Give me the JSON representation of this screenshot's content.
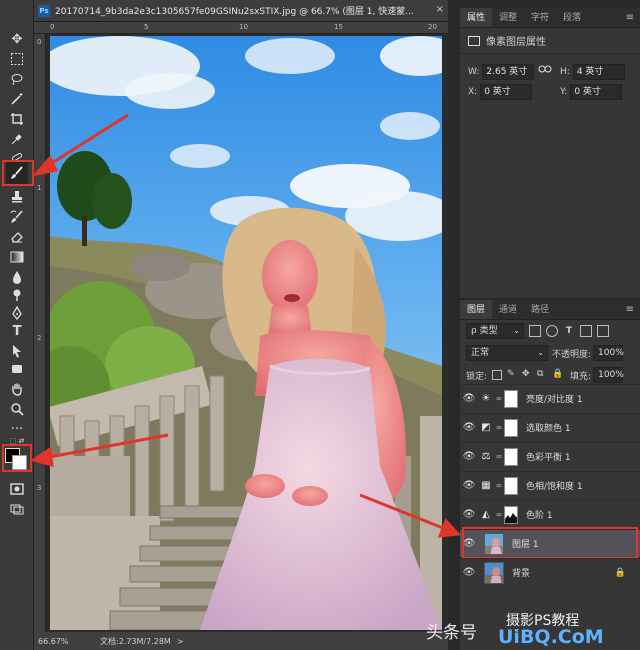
{
  "document": {
    "ps_badge": "Ps",
    "tab_title": "20170714_9b3da2e3c1305657fe09GSINu2sxSTIX.jpg @ 66.7% (图层 1, 快速蒙...",
    "close": "×",
    "ruler_top": [
      "0",
      "5",
      "10",
      "15",
      "20"
    ],
    "ruler_left": [
      "0",
      "1",
      "2",
      "3"
    ],
    "zoom": "66.67%",
    "doc_size": "文档:2.73M/7.28M",
    "status_arrow": ">"
  },
  "toolbar": {
    "selected_tool": "brush-tool",
    "foreground_color": "#000000",
    "background_color": "#ffffff"
  },
  "properties": {
    "tabs": [
      "属性",
      "调整",
      "字符",
      "段落"
    ],
    "active_tab": "属性",
    "header": "像素图层属性",
    "w_label": "W:",
    "w_value": "2.65 英寸",
    "h_label": "H:",
    "h_value": "4 英寸",
    "x_label": "X:",
    "x_value": "0 英寸",
    "y_label": "Y:",
    "y_value": "0 英寸"
  },
  "layers_panel": {
    "tabs": [
      "图层",
      "通道",
      "路径"
    ],
    "active_tab": "图层",
    "filter_label": "ρ 类型",
    "blend_mode": "正常",
    "opacity_label": "不透明度:",
    "opacity_value": "100%",
    "lock_label": "锁定:",
    "fill_label": "填充:",
    "fill_value": "100%",
    "layers": [
      {
        "name": "亮度/对比度 1",
        "icon": "☀"
      },
      {
        "name": "选取颜色 1",
        "icon": "◩"
      },
      {
        "name": "色彩平衡 1",
        "icon": "⚖"
      },
      {
        "name": "色相/饱和度 1",
        "icon": "▦"
      },
      {
        "name": "色阶 1",
        "icon": "◭"
      },
      {
        "name": "图层 1"
      },
      {
        "name": "背景"
      }
    ],
    "selected_layer": "图层 1"
  },
  "watermark": {
    "line1": "头条号",
    "line2": "摄影PS教程",
    "line3": "UiBQ.CoM"
  },
  "colors": {
    "highlight": "#e0352b",
    "selected_row": "#53525a"
  }
}
